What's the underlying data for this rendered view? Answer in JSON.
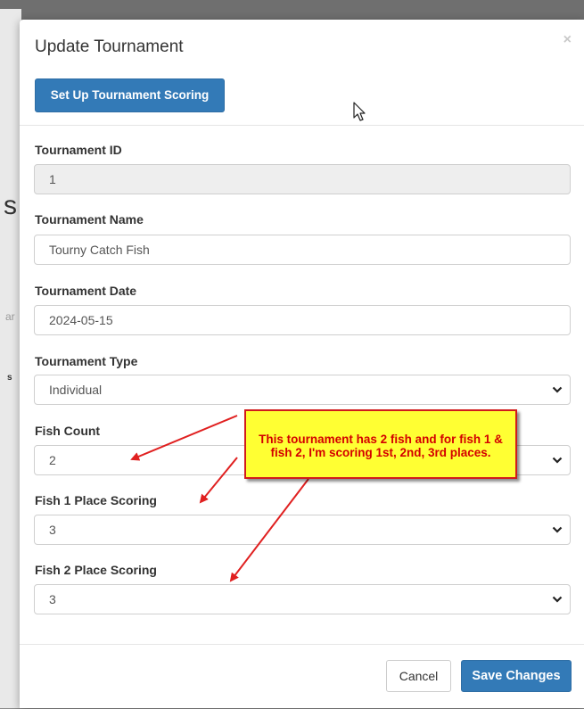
{
  "modal": {
    "title": "Update Tournament",
    "close_label": "×",
    "scoring_button_label": "Set Up Tournament Scoring"
  },
  "fields": {
    "tournament_id": {
      "label": "Tournament ID",
      "value": "1"
    },
    "tournament_name": {
      "label": "Tournament Name",
      "value": "Tourny Catch Fish"
    },
    "tournament_date": {
      "label": "Tournament Date",
      "value": "2024-05-15"
    },
    "tournament_type": {
      "label": "Tournament Type",
      "value": "Individual"
    },
    "fish_count": {
      "label": "Fish Count",
      "value": "2"
    },
    "fish1_place_scoring": {
      "label": "Fish 1 Place Scoring",
      "value": "3"
    },
    "fish2_place_scoring": {
      "label": "Fish 2 Place Scoring",
      "value": "3"
    }
  },
  "footer": {
    "cancel_label": "Cancel",
    "save_label": "Save Changes"
  },
  "annotation": {
    "line1": "This tournament has 2 fish and for fish 1 &",
    "line2": "fish 2, I'm scoring 1st, 2nd, 3rd places."
  },
  "background_fragments": {
    "char_s_large": "s",
    "char_ar": "ar",
    "char_s_small": "s"
  },
  "colors": {
    "primary": "#337ab7",
    "callout_bg": "#ffff33",
    "callout_text": "#d40000",
    "arrow": "#e02020"
  },
  "icons": {
    "dropdown": "chevron-down-icon",
    "cursor": "mouse-pointer-icon",
    "close": "close-icon"
  }
}
